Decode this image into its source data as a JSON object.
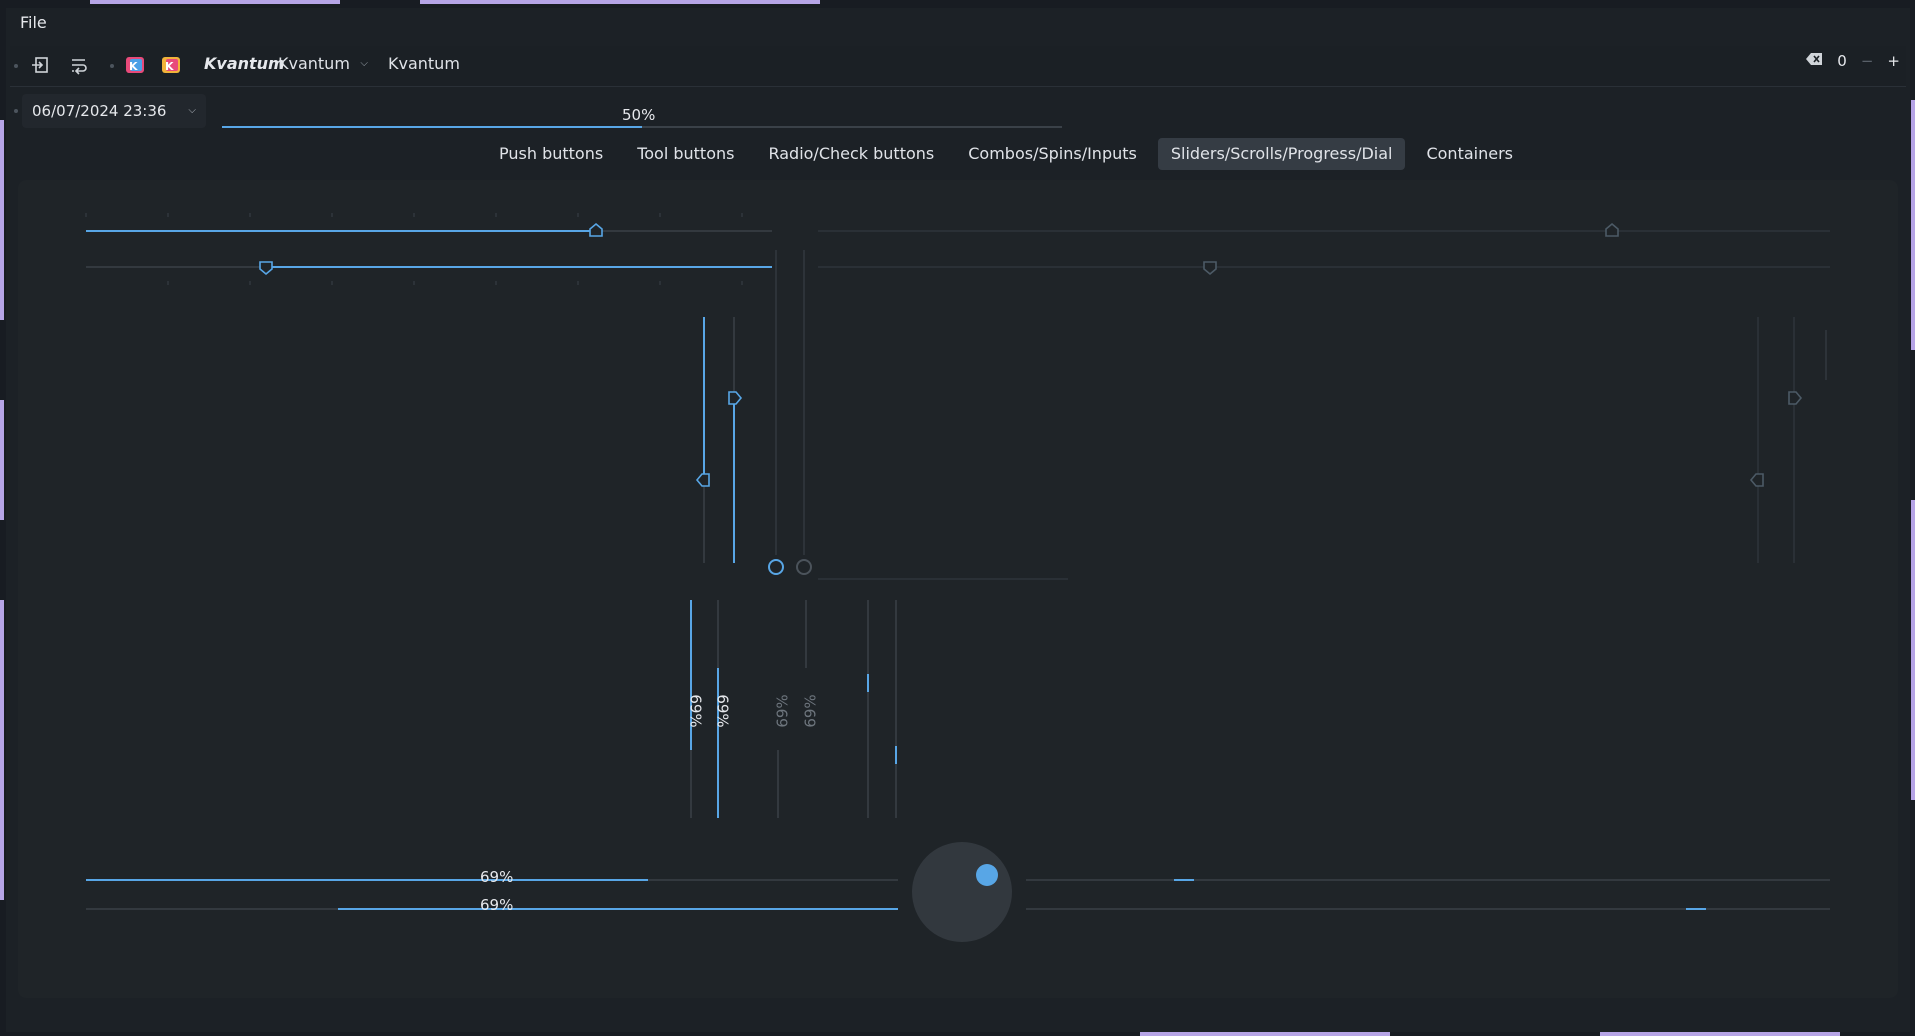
{
  "window": {
    "menu": {
      "file_label": "File"
    },
    "toolbar": {
      "style_name_italic": "Kvantum",
      "style_combo_value": "Kvantum",
      "style_label": "Kvantum",
      "spin_value": "0",
      "minus_label": "−",
      "plus_label": "+"
    },
    "datetime": {
      "value": "06/07/2024 23:36"
    },
    "top_progress": {
      "label": "50%",
      "value": 50
    },
    "tabs": [
      {
        "label": "Push buttons",
        "active": false
      },
      {
        "label": "Tool buttons",
        "active": false
      },
      {
        "label": "Radio/Check buttons",
        "active": false
      },
      {
        "label": "Combos/Spins/Inputs",
        "active": false
      },
      {
        "label": "Sliders/Scrolls/Progress/Dial",
        "active": true
      },
      {
        "label": "Containers",
        "active": false
      }
    ],
    "sliders": {
      "horizontal_enabled_1": {
        "value": 0.74
      },
      "horizontal_enabled_2": {
        "value": 0.26
      },
      "horizontal_disabled_1": {
        "value": 0.74
      },
      "horizontal_disabled_2": {
        "value": 0.26
      }
    },
    "progress": {
      "horizontal_1_label": "69%",
      "horizontal_2_label": "69%",
      "vertical_1_label": "69%",
      "vertical_2_label": "69%",
      "vertical_3_label": "69%",
      "vertical_4_label": "69%",
      "value": 69
    },
    "colors": {
      "accent": "#58a6e6",
      "background": "#1c2126",
      "panel": "#1f2428",
      "track": "#33393f",
      "text": "#e6e8ec",
      "border_decoration": "#b6a4e6"
    },
    "icons": [
      "login-icon",
      "wrap-icon",
      "kvantum-logo-icon",
      "kvantum-logo-icon",
      "clear-icon"
    ]
  }
}
